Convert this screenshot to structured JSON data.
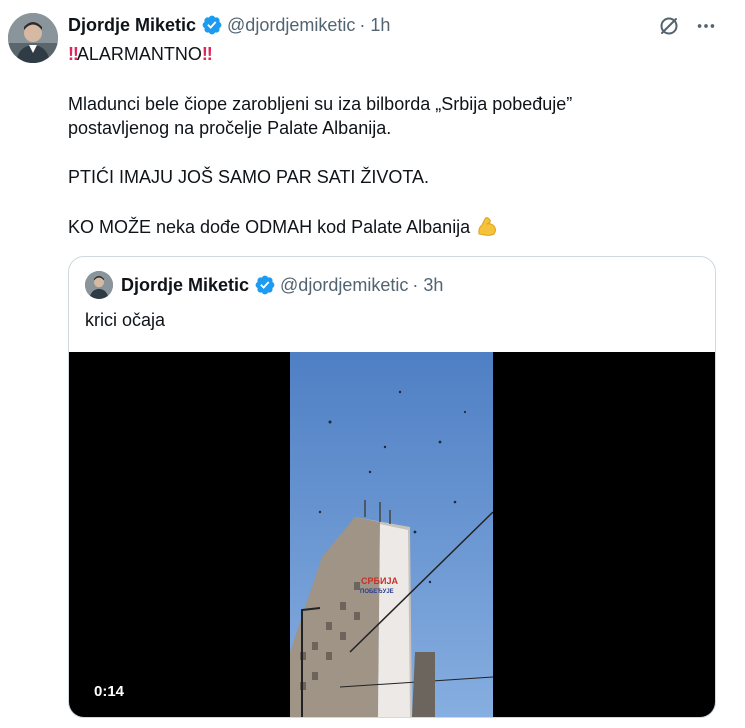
{
  "tweet": {
    "author_name": "Djordje Miketic",
    "handle": "@djordjemiketic",
    "time": "· 1h",
    "paragraphs": [
      "ALARMANTNO",
      "Mladunci bele čiope zarobljeni su iza bilborda „Srbija pobeđuje”",
      "postavljenog na pročelje Palate Albanija.",
      "PTIĆI IMAJU JOŠ SAMO PAR SATI ŽIVOTA.",
      "KO MOŽE neka dođe ODMAH kod Palate Albanija"
    ],
    "icons": {
      "emphasis": "double-exclamation-icon",
      "emoji": "flexed-biceps-icon",
      "grok": "grok-icon",
      "more": "more-icon",
      "verified": "verified-badge-icon"
    }
  },
  "quote": {
    "author_name": "Djordje Miketic",
    "handle": "@djordjemiketic",
    "time": "· 3h",
    "text": "krici očaja",
    "video": {
      "duration": "0:14",
      "billboard_line1": "СРБИЈА",
      "billboard_line2": "ПОБЕЂУЈЕ"
    }
  },
  "colors": {
    "verified": "#1d9bf0",
    "muted": "#536471",
    "border": "#cfd9de",
    "emphasis": "#e0245e"
  }
}
